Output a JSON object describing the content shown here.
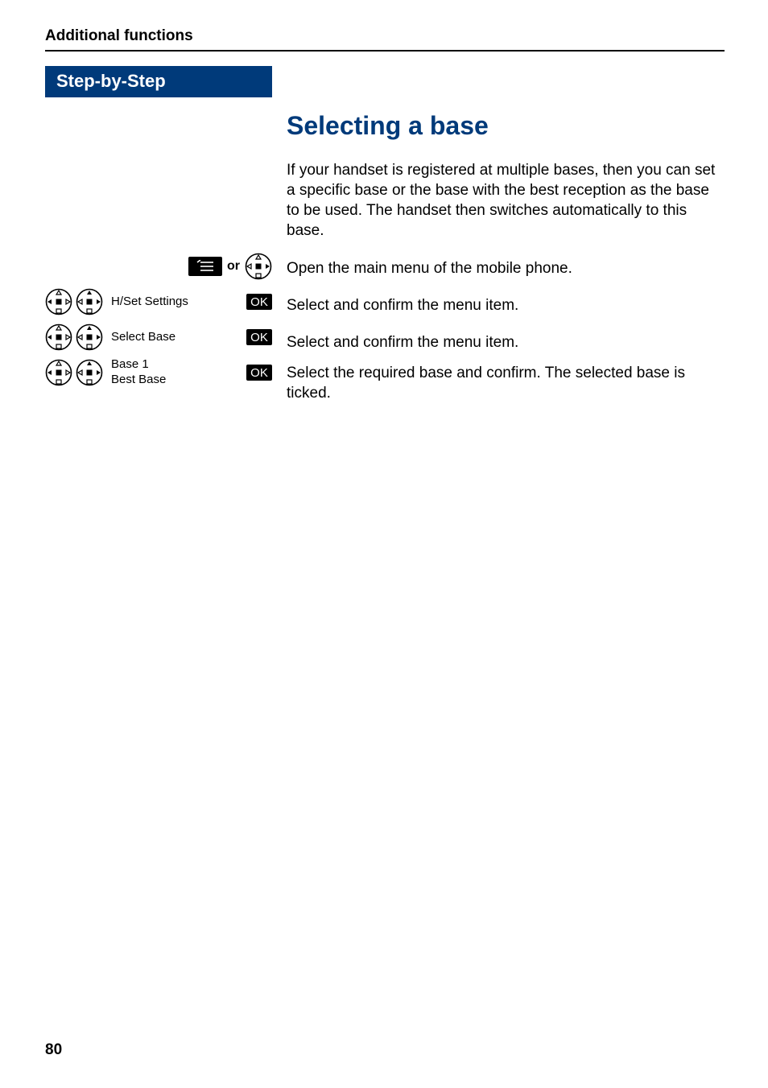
{
  "header": {
    "section": "Additional functions"
  },
  "left": {
    "step_label": "Step-by-Step",
    "or_text": "or",
    "ok_label": "OK",
    "rows": [
      {
        "label": "H/Set Settings"
      },
      {
        "label": "Select Base"
      },
      {
        "label": "Base 1\nBest Base"
      }
    ]
  },
  "right": {
    "heading": "Selecting a base",
    "intro": "If your handset is registered at multiple bases, then you can set a specific base or the base with the best reception as the base to be used. The handset then switches automatically to this base.",
    "instructions": [
      "Open the main menu of the mobile phone.",
      "Select and confirm the menu item.",
      "Select and confirm the menu item.",
      "Select the required base and confirm. The selected base is ticked."
    ]
  },
  "page_number": "80"
}
